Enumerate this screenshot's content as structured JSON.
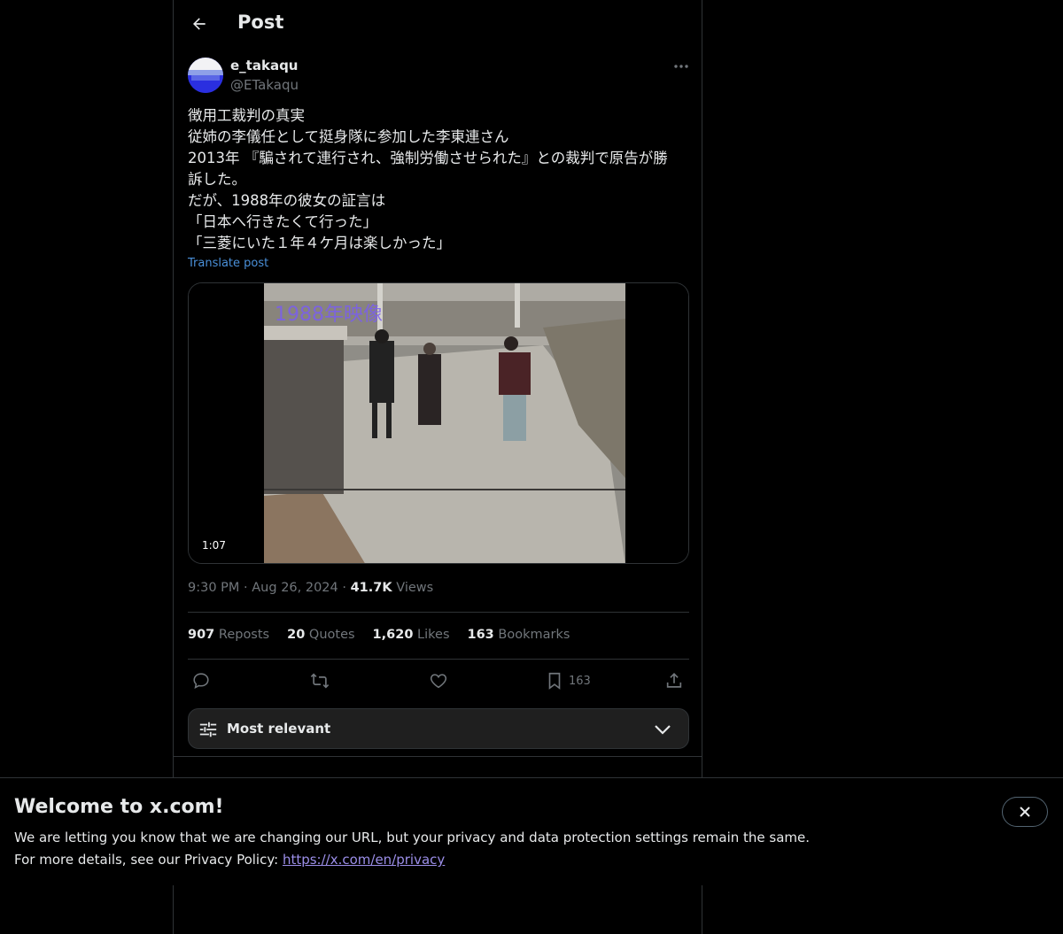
{
  "header": {
    "title": "Post"
  },
  "post": {
    "author": {
      "name": "e_takaqu",
      "handle": "@ETakaqu"
    },
    "lines": [
      "徴用工裁判の真実",
      "従姉の李儀任として挺身隊に参加した李東連さん",
      "2013年 『騙されて連行され、強制労働させられた』との裁判で原告が勝",
      "訴した。",
      "だが、1988年の彼女の証言は",
      "「日本へ行きたくて行った」",
      "「三菱にいた１年４ケ月は楽しかった」"
    ],
    "translate": "Translate post",
    "video": {
      "duration": "1:07",
      "overlay_text": "1988年映像"
    },
    "time": "9:30 PM",
    "separator": "·",
    "date": "Aug 26, 2024",
    "views_count": "41.7K",
    "views_label": "Views",
    "stats": {
      "reposts_count": "907",
      "reposts_label": "Reposts",
      "quotes_count": "20",
      "quotes_label": "Quotes",
      "likes_count": "1,620",
      "likes_label": "Likes",
      "bookmarks_count": "163",
      "bookmarks_label": "Bookmarks"
    },
    "actions": {
      "bookmark_count": "163"
    }
  },
  "replies_sort": {
    "label": "Most relevant"
  },
  "banner": {
    "title": "Welcome to x.com!",
    "line1": "We are letting you know that we are changing our URL, but your privacy and data protection settings remain the same.",
    "line2_prefix": "For more details, see our Privacy Policy: ",
    "link": "https://x.com/en/privacy"
  },
  "icons": [
    "back-arrow-icon",
    "more-icon",
    "reply-icon",
    "repost-icon",
    "like-icon",
    "bookmark-icon",
    "share-icon",
    "tune-icon",
    "chevron-down-icon",
    "close-icon"
  ],
  "colors": {
    "background": "#000000",
    "text": "#e7e9ea",
    "muted": "#71767b",
    "link": "#4a90d9",
    "border": "#2f3336"
  }
}
